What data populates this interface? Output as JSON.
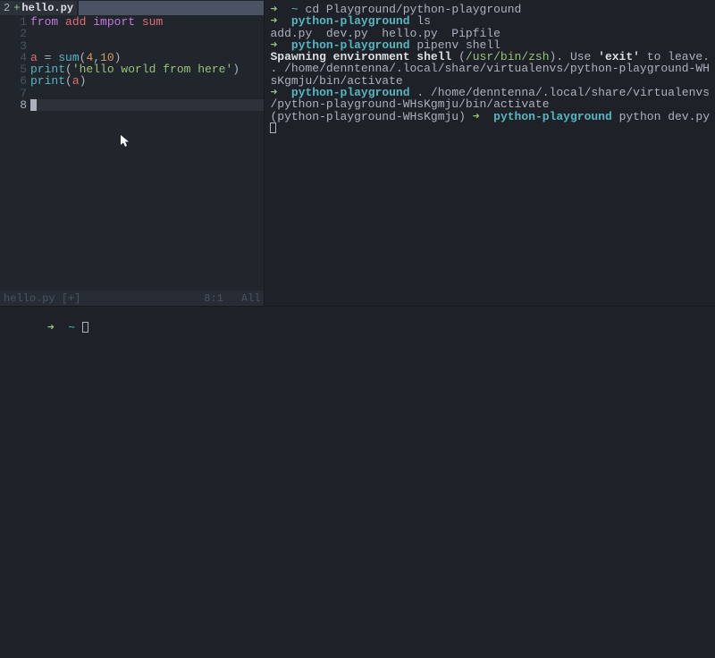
{
  "editor": {
    "tab": {
      "number": "2",
      "plus": "+",
      "filename": "hello.py"
    },
    "lines": [
      {
        "n": "1",
        "tokens": [
          {
            "t": "from ",
            "c": "kw-from"
          },
          {
            "t": "add ",
            "c": "ident"
          },
          {
            "t": "import ",
            "c": "kw-import"
          },
          {
            "t": "sum",
            "c": "ident"
          }
        ]
      },
      {
        "n": "2",
        "tokens": []
      },
      {
        "n": "3",
        "tokens": []
      },
      {
        "n": "4",
        "tokens": [
          {
            "t": "a ",
            "c": "ident"
          },
          {
            "t": "= ",
            "c": "paren"
          },
          {
            "t": "sum",
            "c": "fn-call"
          },
          {
            "t": "(",
            "c": "paren"
          },
          {
            "t": "4",
            "c": "number"
          },
          {
            "t": ",",
            "c": "paren"
          },
          {
            "t": "10",
            "c": "number"
          },
          {
            "t": ")",
            "c": "paren"
          }
        ]
      },
      {
        "n": "5",
        "tokens": [
          {
            "t": "print",
            "c": "fn-call"
          },
          {
            "t": "(",
            "c": "paren"
          },
          {
            "t": "'hello world from here'",
            "c": "string"
          },
          {
            "t": ")",
            "c": "paren"
          }
        ]
      },
      {
        "n": "6",
        "tokens": [
          {
            "t": "print",
            "c": "fn-call"
          },
          {
            "t": "(",
            "c": "paren"
          },
          {
            "t": "a",
            "c": "ident"
          },
          {
            "t": ")",
            "c": "paren"
          }
        ]
      },
      {
        "n": "7",
        "tokens": []
      },
      {
        "n": "8",
        "tokens": [],
        "cursor": true,
        "current": true
      }
    ],
    "status": {
      "file": "hello.py [+]",
      "pos": "8:1",
      "mode": "All"
    }
  },
  "terminal_right": {
    "lines": [
      {
        "segments": [
          {
            "t": "➜  ",
            "c": "arrow"
          },
          {
            "t": "~",
            "c": "tilde"
          },
          {
            "t": " cd Playground/python-playground",
            "c": "cmd-text"
          }
        ]
      },
      {
        "segments": [
          {
            "t": "➜  ",
            "c": "arrow"
          },
          {
            "t": "python-playground",
            "c": "cwd"
          },
          {
            "t": " ls",
            "c": "cmd-text"
          }
        ]
      },
      {
        "segments": [
          {
            "t": "add.py  dev.py  hello.py  Pipfile",
            "c": "cmd-text"
          }
        ]
      },
      {
        "segments": [
          {
            "t": "➜  ",
            "c": "arrow"
          },
          {
            "t": "python-playground",
            "c": "cwd"
          },
          {
            "t": " pipenv shell",
            "c": "cmd-text"
          }
        ]
      },
      {
        "segments": [
          {
            "t": "Spawning environment shell ",
            "c": "bold"
          },
          {
            "t": "(",
            "c": "cmd-text"
          },
          {
            "t": "/usr/bin/zsh",
            "c": "path-highlight"
          },
          {
            "t": "). Use ",
            "c": "cmd-text"
          },
          {
            "t": "'exit'",
            "c": "bold"
          },
          {
            "t": " to leave.",
            "c": "cmd-text"
          }
        ]
      },
      {
        "segments": [
          {
            "t": ". /home/denntenna/.local/share/virtualenvs/python-playground-WH",
            "c": "cmd-text"
          }
        ]
      },
      {
        "segments": [
          {
            "t": "sKgmju/bin/activate",
            "c": "cmd-text"
          }
        ]
      },
      {
        "segments": [
          {
            "t": "➜  ",
            "c": "arrow"
          },
          {
            "t": "python-playground",
            "c": "cwd"
          },
          {
            "t": " . /home/denntenna/.local/share/virtualenvs",
            "c": "cmd-text"
          }
        ]
      },
      {
        "segments": [
          {
            "t": "/python-playground-WHsKgmju/bin/activate",
            "c": "cmd-text"
          }
        ]
      },
      {
        "segments": [
          {
            "t": "(python-playground-WHsKgmju) ",
            "c": "venv"
          },
          {
            "t": "➜  ",
            "c": "arrow"
          },
          {
            "t": "python-playground",
            "c": "cwd"
          },
          {
            "t": " python dev.py",
            "c": "cmd-text"
          }
        ]
      }
    ]
  },
  "terminal_bottom": {
    "prompt_arrow": "➜  ",
    "prompt_path": "~"
  }
}
